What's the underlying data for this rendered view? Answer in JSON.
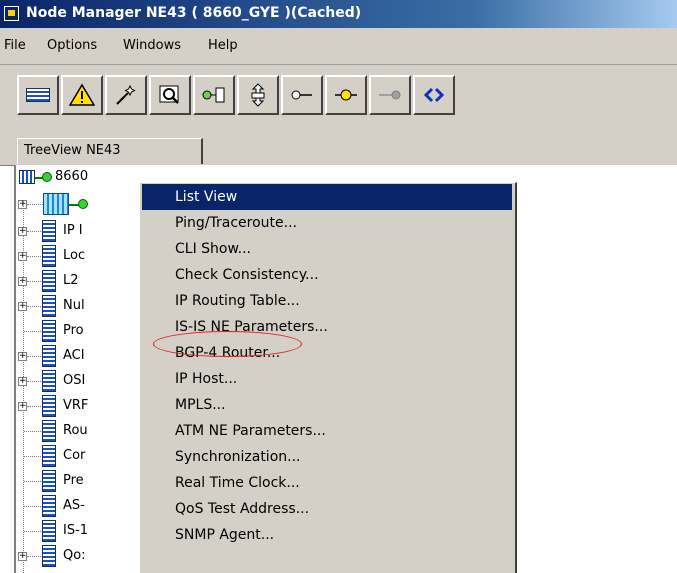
{
  "window": {
    "title": "Node Manager NE43 ( 8660_GYE )(Cached)"
  },
  "menubar": {
    "items": [
      "File",
      "Options",
      "Windows",
      "Help"
    ]
  },
  "toolbar": {
    "buttons": [
      {
        "icon": "list-view-icon"
      },
      {
        "icon": "warning-icon"
      },
      {
        "icon": "wand-icon"
      },
      {
        "icon": "inspect-icon"
      },
      {
        "icon": "connector-icon"
      },
      {
        "icon": "move-icon"
      },
      {
        "icon": "link-white-icon"
      },
      {
        "icon": "link-yellow-icon"
      },
      {
        "icon": "link-gray-icon"
      },
      {
        "icon": "sync-icon"
      }
    ]
  },
  "tabs": {
    "active": "TreeView  NE43"
  },
  "tree": {
    "root_label": "8660",
    "items": [
      "IP I",
      "Loc",
      "L2 ",
      "Nul",
      "Pro",
      "ACI",
      "OSI",
      "VRF",
      "Rou",
      "Cor",
      "Pre",
      "AS-",
      "IS-1",
      "Qo:"
    ]
  },
  "context_menu": {
    "items": [
      "List View",
      "Ping/Traceroute...",
      "CLI Show...",
      "Check Consistency...",
      "IP Routing Table...",
      "IS-IS NE Parameters...",
      "BGP-4 Router...",
      "IP Host...",
      "MPLS...",
      "ATM NE Parameters...",
      "Synchronization...",
      "Real Time Clock...",
      "QoS Test Address...",
      "SNMP Agent..."
    ],
    "selected_index": 0,
    "highlighted_label": "BGP-4 Router..."
  },
  "colors": {
    "highlight": "#0a246a",
    "annotation_circle": "#e02020",
    "face": "#d4d0c8"
  }
}
